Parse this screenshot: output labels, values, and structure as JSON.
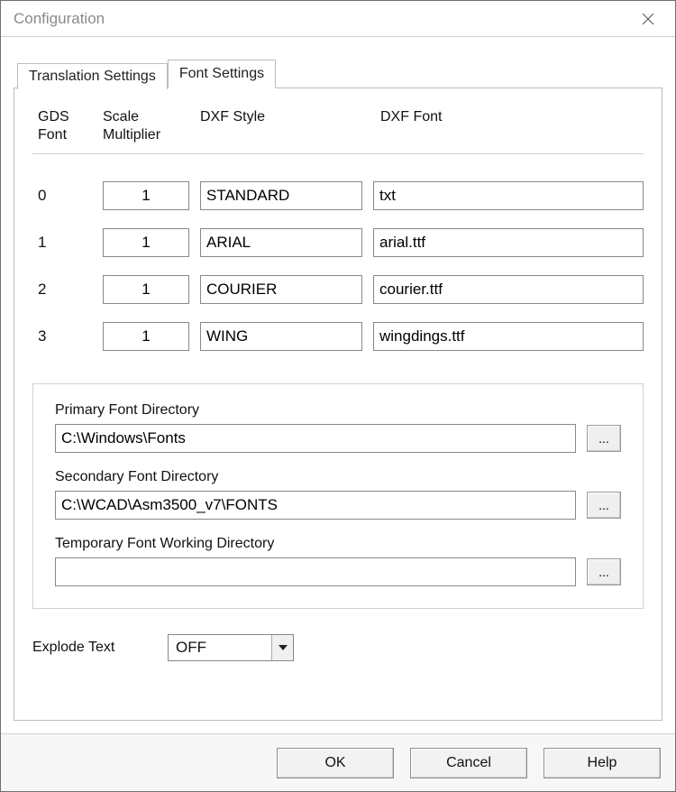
{
  "window": {
    "title": "Configuration"
  },
  "tabs": {
    "translation": "Translation Settings",
    "font": "Font Settings"
  },
  "columns": {
    "gds": "GDS\nFont",
    "scale": "Scale\nMultiplier",
    "style": "DXF Style",
    "font": "DXF Font"
  },
  "font_rows": [
    {
      "index": "0",
      "scale": "1",
      "style": "STANDARD",
      "font": "txt"
    },
    {
      "index": "1",
      "scale": "1",
      "style": "ARIAL",
      "font": "arial.ttf"
    },
    {
      "index": "2",
      "scale": "1",
      "style": "COURIER",
      "font": "courier.ttf"
    },
    {
      "index": "3",
      "scale": "1",
      "style": "WING",
      "font": "wingdings.ttf"
    }
  ],
  "dirs": {
    "primary_label": "Primary Font Directory",
    "primary_value": "C:\\Windows\\Fonts",
    "secondary_label": "Secondary Font Directory",
    "secondary_value": "C:\\WCAD\\Asm3500_v7\\FONTS",
    "temp_label": "Temporary Font Working Directory",
    "temp_value": "",
    "browse_label": "..."
  },
  "explode": {
    "label": "Explode Text",
    "value": "OFF"
  },
  "footer": {
    "ok": "OK",
    "cancel": "Cancel",
    "help": "Help"
  }
}
